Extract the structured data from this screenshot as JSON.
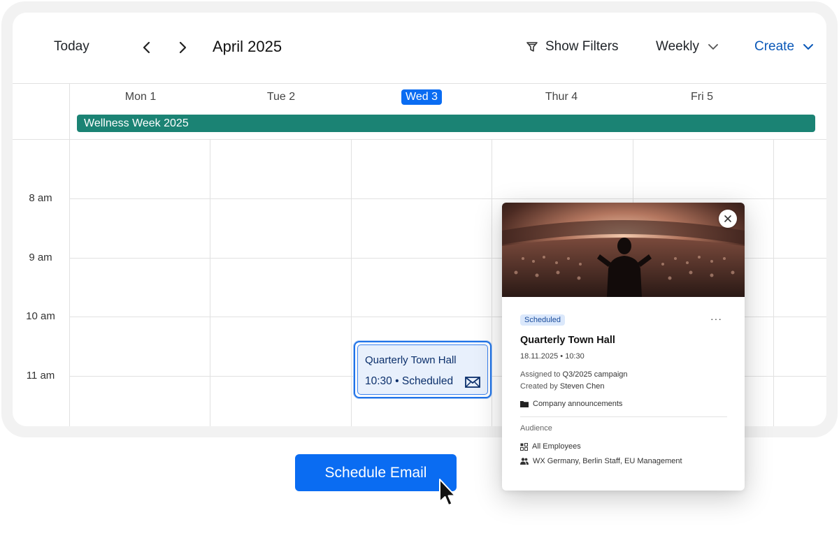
{
  "toolbar": {
    "today_label": "Today",
    "month_label": "April 2025",
    "filters_label": "Show Filters",
    "view_label": "Weekly",
    "create_label": "Create",
    "accent_color": "#0a58b8"
  },
  "days": [
    {
      "label": "Mon 1"
    },
    {
      "label": "Tue 2"
    },
    {
      "label": "Wed 3",
      "is_today": true
    },
    {
      "label": "Thur 4"
    },
    {
      "label": "Fri 5"
    }
  ],
  "all_day_event": {
    "title": "Wellness Week 2025",
    "color": "#1b8374"
  },
  "time_labels": [
    "8 am",
    "9 am",
    "10 am",
    "11 am"
  ],
  "event": {
    "title": "Quarterly Town Hall",
    "time": "10:30",
    "separator": "•",
    "status": "Scheduled",
    "icon": "mail-icon"
  },
  "popover": {
    "status_badge": "Scheduled",
    "more_label": "···",
    "title": "Quarterly Town Hall",
    "date_time": "18.11.2025 • 10:30",
    "assigned_prefix": "Assigned to",
    "assigned_value": "Q3/2025 campaign",
    "created_prefix": "Created by",
    "created_value": "Steven Chen",
    "folder": "Company announcements",
    "audience_header": "Audience",
    "audience_all": "All Employees",
    "audience_groups": "WX Germany, Berlin Staff, EU Management"
  },
  "schedule_button_label": "Schedule Email",
  "colors": {
    "primary": "#0a6cf2",
    "today_badge": "#0a6cf2",
    "event_border": "#1f73e8",
    "event_fill": "#e8f0fc"
  }
}
